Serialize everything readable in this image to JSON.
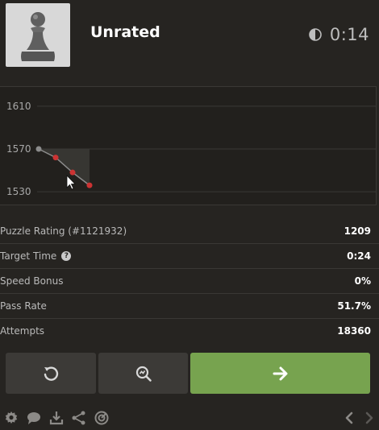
{
  "header": {
    "title": "Unrated",
    "timer": "0:14",
    "timer_icon": "half-circle-icon",
    "avatar_icon": "chess-pawn-icon"
  },
  "chart_data": {
    "type": "line",
    "y_ticks": [
      "1610",
      "1570",
      "1530"
    ],
    "ylim": [
      1518,
      1628
    ],
    "x": [
      0,
      1,
      2,
      3
    ],
    "values": [
      1570,
      1562,
      1548,
      1536
    ],
    "colors": {
      "line": "#8c8c8c",
      "point": "#c33",
      "first_point": "#8c8c8c",
      "grid": "#3a3835",
      "area": "#3a3835"
    }
  },
  "stats": [
    {
      "label": "Puzzle Rating (#1121932)",
      "value": "1209",
      "help": false
    },
    {
      "label": "Target Time",
      "value": "0:24",
      "help": true
    },
    {
      "label": "Speed Bonus",
      "value": "0%",
      "help": false
    },
    {
      "label": "Pass Rate",
      "value": "51.7%",
      "help": false
    },
    {
      "label": "Attempts",
      "value": "18360",
      "help": false
    }
  ],
  "actions": {
    "retry_icon": "retry-icon",
    "analyze_icon": "analysis-icon",
    "next_icon": "arrow-right-icon"
  },
  "footer": {
    "icons": [
      "gear-icon",
      "chat-icon",
      "download-icon",
      "share-icon",
      "target-icon"
    ],
    "nav": [
      "chevron-left-icon",
      "chevron-right-icon"
    ]
  },
  "theme": {
    "background": "#262421",
    "accent_green": "#77a34f",
    "button_gray": "#3c3a37"
  }
}
